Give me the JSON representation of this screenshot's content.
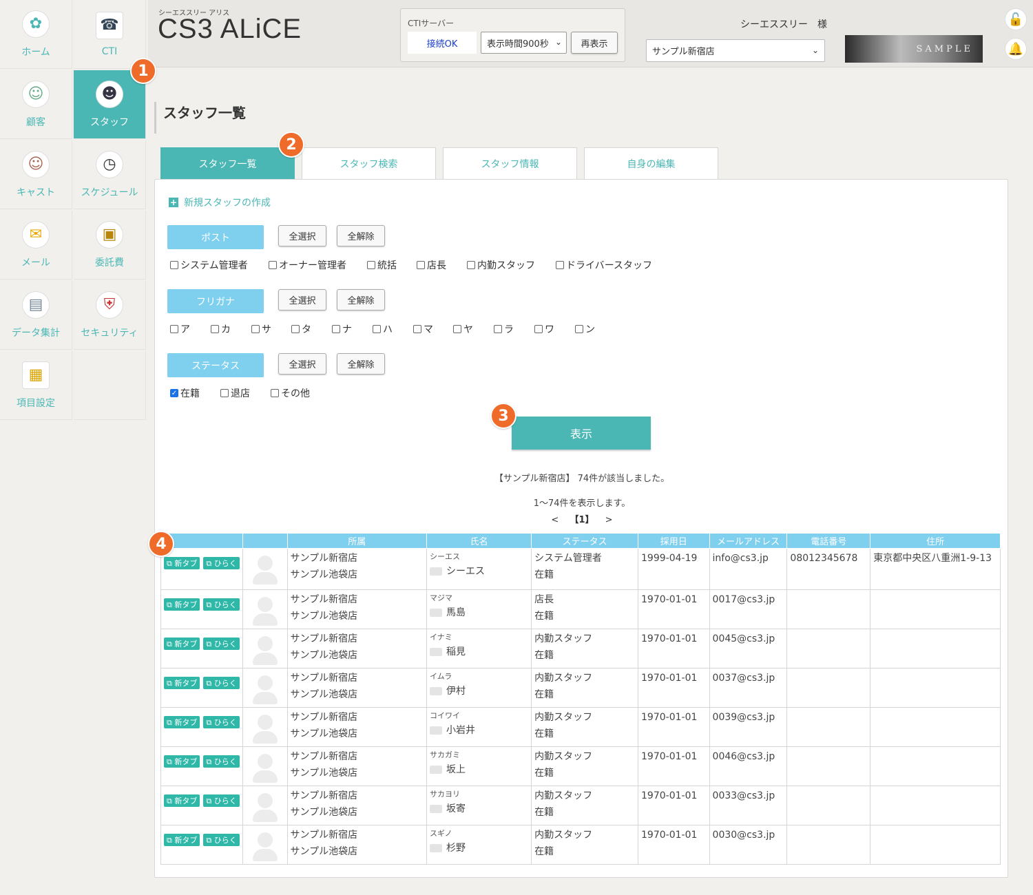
{
  "sidebar": {
    "items": [
      {
        "label": "ホーム",
        "icon": "rabbit-icon"
      },
      {
        "label": "CTI",
        "icon": "phone-icon"
      },
      {
        "label": "顧客",
        "icon": "customer-icon"
      },
      {
        "label": "スタッフ",
        "icon": "staff-icon"
      },
      {
        "label": "キャスト",
        "icon": "cast-icon"
      },
      {
        "label": "スケジュール",
        "icon": "clock-icon"
      },
      {
        "label": "メール",
        "icon": "mail-icon"
      },
      {
        "label": "委託費",
        "icon": "wallet-icon"
      },
      {
        "label": "データ集計",
        "icon": "report-icon"
      },
      {
        "label": "セキュリティ",
        "icon": "shield-icon"
      },
      {
        "label": "項目設定",
        "icon": "clipboard-icon"
      }
    ]
  },
  "header": {
    "app_subtitle": "シーエススリー アリス",
    "app_title": "CS3 ALiCE",
    "cti": {
      "label": "CTIサーバー",
      "status": "接続OK",
      "interval": "表示時間900秒",
      "refresh": "再表示"
    },
    "user": "シーエススリー　様",
    "shop": "サンプル新宿店",
    "banner_text": "SAMPLE"
  },
  "page": {
    "title": "スタッフ一覧"
  },
  "tabs": [
    "スタッフ一覧",
    "スタッフ検索",
    "スタッフ情報",
    "自身の編集"
  ],
  "panel": {
    "new_staff": "新規スタッフの作成",
    "select_all": "全選択",
    "clear_all": "全解除",
    "post": {
      "label": "ポスト",
      "options": [
        "システム管理者",
        "オーナー管理者",
        "統括",
        "店長",
        "内勤スタッフ",
        "ドライバースタッフ"
      ]
    },
    "furigana": {
      "label": "フリガナ",
      "options": [
        "ア",
        "カ",
        "サ",
        "タ",
        "ナ",
        "ハ",
        "マ",
        "ヤ",
        "ラ",
        "ワ",
        "ン"
      ]
    },
    "status": {
      "label": "ステータス",
      "options": [
        {
          "label": "在籍",
          "checked": true
        },
        {
          "label": "退店",
          "checked": false
        },
        {
          "label": "その他",
          "checked": false
        }
      ]
    },
    "show_button": "表示",
    "result_summary": "【サンプル新宿店】 74件が該当しました。",
    "result_range": "1〜74件を表示します。",
    "pager": {
      "prev": "<",
      "current": "【1】",
      "next": ">"
    }
  },
  "table": {
    "headers": [
      "",
      "",
      "所属",
      "氏名",
      "ステータス",
      "採用日",
      "メールアドレス",
      "電話番号",
      "住所"
    ],
    "new_tab": "新タブ",
    "open": "ひらく",
    "rows": [
      {
        "shop1": "サンプル新宿店",
        "shop2": "サンプル池袋店",
        "kana": "シーエス",
        "name": "シーエス",
        "post": "システム管理者",
        "status": "在籍",
        "hired": "1999-04-19",
        "email": "info@cs3.jp",
        "phone": "08012345678",
        "address": "東京都中央区八重洲1-9-13"
      },
      {
        "shop1": "サンプル新宿店",
        "shop2": "サンプル池袋店",
        "kana": "マジマ",
        "name": "馬島",
        "post": "店長",
        "status": "在籍",
        "hired": "1970-01-01",
        "email": "0017@cs3.jp",
        "phone": "",
        "address": ""
      },
      {
        "shop1": "サンプル新宿店",
        "shop2": "サンプル池袋店",
        "kana": "イナミ",
        "name": "稲見",
        "post": "内勤スタッフ",
        "status": "在籍",
        "hired": "1970-01-01",
        "email": "0045@cs3.jp",
        "phone": "",
        "address": ""
      },
      {
        "shop1": "サンプル新宿店",
        "shop2": "サンプル池袋店",
        "kana": "イムラ",
        "name": "伊村",
        "post": "内勤スタッフ",
        "status": "在籍",
        "hired": "1970-01-01",
        "email": "0037@cs3.jp",
        "phone": "",
        "address": ""
      },
      {
        "shop1": "サンプル新宿店",
        "shop2": "サンプル池袋店",
        "kana": "コイワイ",
        "name": "小岩井",
        "post": "内勤スタッフ",
        "status": "在籍",
        "hired": "1970-01-01",
        "email": "0039@cs3.jp",
        "phone": "",
        "address": ""
      },
      {
        "shop1": "サンプル新宿店",
        "shop2": "サンプル池袋店",
        "kana": "サカガミ",
        "name": "坂上",
        "post": "内勤スタッフ",
        "status": "在籍",
        "hired": "1970-01-01",
        "email": "0046@cs3.jp",
        "phone": "",
        "address": ""
      },
      {
        "shop1": "サンプル新宿店",
        "shop2": "サンプル池袋店",
        "kana": "サカヨリ",
        "name": "坂寄",
        "post": "内勤スタッフ",
        "status": "在籍",
        "hired": "1970-01-01",
        "email": "0033@cs3.jp",
        "phone": "",
        "address": ""
      },
      {
        "shop1": "サンプル新宿店",
        "shop2": "サンプル池袋店",
        "kana": "スギノ",
        "name": "杉野",
        "post": "内勤スタッフ",
        "status": "在籍",
        "hired": "1970-01-01",
        "email": "0030@cs3.jp",
        "phone": "",
        "address": ""
      }
    ]
  },
  "badges": [
    "1",
    "2",
    "3",
    "4"
  ],
  "colors": {
    "accent": "#4ab7b5",
    "label_blue": "#7fcfef",
    "badge": "#ee6b2a"
  }
}
